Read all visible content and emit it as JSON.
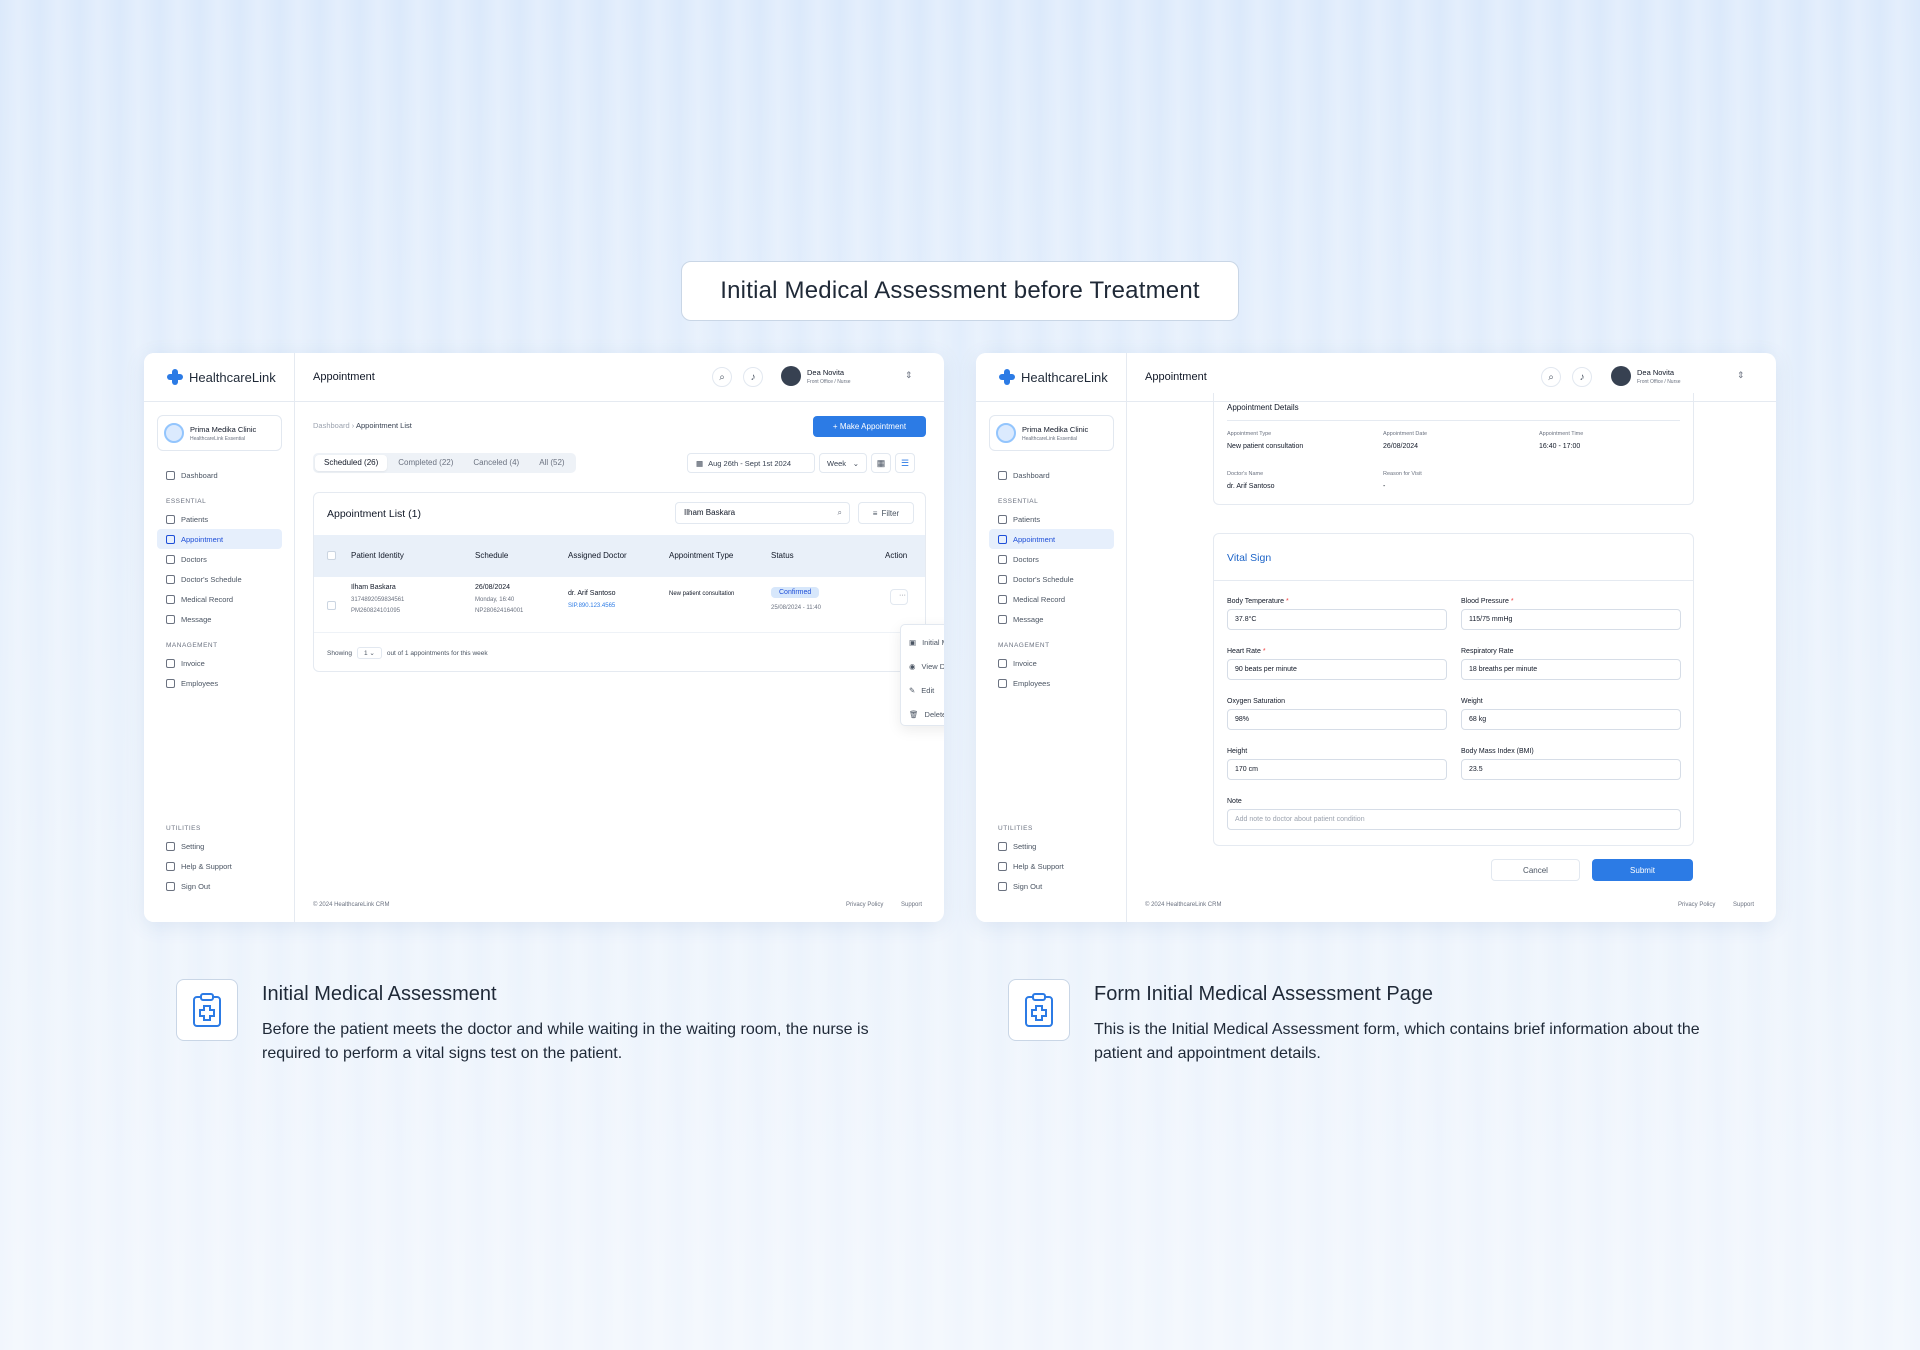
{
  "headline": "Initial Medical Assessment before Treatment",
  "app": {
    "brand": "HealthcareLink",
    "clinic_name": "Prima Medika Clinic",
    "clinic_plan": "HealthcareLink Essential",
    "user_name": "Dea Novita",
    "user_role": "Front Office / Nurse",
    "page_title": "Appointment",
    "footer_copy": "© 2024 HealthcareLink CRM",
    "footer_privacy": "Privacy Policy",
    "footer_support": "Support",
    "accent": "#2c7be5"
  },
  "sidebar": {
    "dashboard": "Dashboard",
    "section_essential": "ESSENTIAL",
    "patients": "Patients",
    "appointment": "Appointment",
    "doctors": "Doctors",
    "doctors_schedule": "Doctor's Schedule",
    "medical_record": "Medical Record",
    "message": "Message",
    "section_management": "MANAGEMENT",
    "invoice": "Invoice",
    "employees": "Employees",
    "section_utilities": "UTILITIES",
    "setting": "Setting",
    "help": "Help & Support",
    "signout": "Sign Out"
  },
  "list_page": {
    "crumb_root": "Dashboard",
    "crumb_current": "Appointment List",
    "make_appointment": "+ Make Appointment",
    "tabs": [
      "Scheduled (26)",
      "Completed (22)",
      "Canceled (4)",
      "All (52)"
    ],
    "date_range": "Aug 26th - Sept 1st 2024",
    "period": "Week",
    "card_title": "Appointment List (1)",
    "search_value": "Ilham Baskara",
    "filter": "Filter",
    "columns": [
      "Patient Identity",
      "Schedule",
      "Assigned Doctor",
      "Appointment Type",
      "Status",
      "Action"
    ],
    "row": {
      "patient_name": "Ilham Baskara",
      "patient_nik": "3174892059834561",
      "patient_mr": "PM260824101095",
      "date": "26/08/2024",
      "time": "Monday, 16:40",
      "booking": "NP280624164001",
      "doctor": "dr. Arif Santoso",
      "doctor_id": "SIP.890.123.4565",
      "type": "New patient consultation",
      "status": "Confirmed",
      "status_sub": "25/08/2024 - 11:40"
    },
    "showing_pre": "Showing",
    "showing_value": "1",
    "showing_post": "out of 1 appointments for this week",
    "menu": [
      "Initial Medical Assessment",
      "View Details",
      "Edit",
      "Delete"
    ]
  },
  "form_page": {
    "details_title": "Appointment Details",
    "appt_type_label": "Appointment Type",
    "appt_type": "New patient consultation",
    "appt_date_label": "Appointment Date",
    "appt_date": "26/08/2024",
    "appt_time_label": "Appointment Time",
    "appt_time": "16:40 - 17:00",
    "doctor_label": "Doctor's Name",
    "doctor": "dr. Arif Santoso",
    "reason_label": "Reason for Visit",
    "reason": "-",
    "vital_title": "Vital Sign",
    "fields": {
      "body_temp_label": "Body Temperature",
      "body_temp": "37.8°C",
      "bp_label": "Blood Pressure",
      "bp": "115/75 mmHg",
      "hr_label": "Heart Rate",
      "hr": "90 beats per minute",
      "rr_label": "Respiratory Rate",
      "rr": "18 breaths per minute",
      "o2_label": "Oxygen Saturation",
      "o2": "98%",
      "weight_label": "Weight",
      "weight": "68 kg",
      "height_label": "Height",
      "height": "170 cm",
      "bmi_label": "Body Mass Index (BMI)",
      "bmi": "23.5",
      "note_label": "Note",
      "note_placeholder": "Add note to doctor about patient condition",
      "required_mark": "*"
    },
    "cancel": "Cancel",
    "submit": "Submit"
  },
  "captions": [
    {
      "title": "Initial Medical Assessment",
      "text": "Before the patient meets the doctor and while waiting in the waiting room, the nurse is required to perform a vital signs test on the patient."
    },
    {
      "title": "Form Initial Medical Assessment Page",
      "text": "This is the Initial Medical Assessment form, which contains brief information about the patient and appointment details."
    }
  ],
  "icons": [
    "clipboard-plus-icon",
    "search-icon",
    "bell-icon",
    "chevron-updown-icon",
    "calendar-icon",
    "list-icon",
    "filter-icon",
    "more-icon"
  ]
}
